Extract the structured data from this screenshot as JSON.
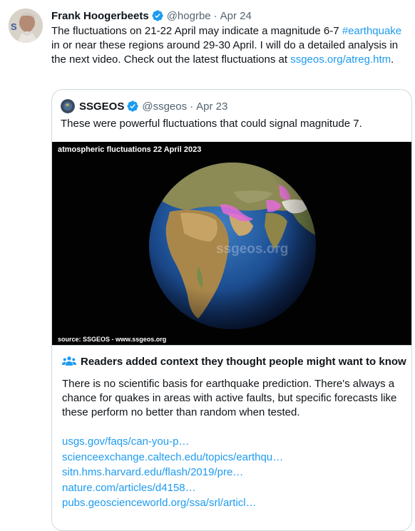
{
  "tweet": {
    "author_name": "Frank Hoogerbeets",
    "handle": "@hogrbe",
    "separator": "·",
    "date": "Apr 24",
    "text_part1": "The fluctuations on 21-22 April may indicate a magnitude 6-7 ",
    "hashtag": "#earthquake",
    "text_part2": " in or near these regions around 29-30 April. I will do a detailed analysis in the next video. Check out the latest fluctuations at ",
    "link": "ssgeos.org/atreg.htm",
    "text_end": "."
  },
  "quoted": {
    "author_name": "SSGEOS",
    "handle": "@ssgeos",
    "separator": "·",
    "date": "Apr 23",
    "text": "These were powerful fluctuations that could signal magnitude 7.",
    "media": {
      "title": "atmospheric fluctuations 22 April 2023",
      "watermark": "ssgeos.org",
      "source": "source: SSGEOS - www.ssgeos.org"
    }
  },
  "context": {
    "heading": "Readers added context they thought people might want to know",
    "body": "There is no scientific basis for earthquake prediction. There's always a chance for quakes in areas with active faults, but specific forecasts like these perform no better than random when tested.",
    "links": [
      "usgs.gov/faqs/can-you-p…",
      "scienceexchange.caltech.edu/topics/earthqu…",
      "sitn.hms.harvard.edu/flash/2019/pre…",
      "nature.com/articles/d4158…",
      "pubs.geoscienceworld.org/ssa/srl/articl…"
    ]
  },
  "colors": {
    "link": "#1d9bf0",
    "verified_badge": "#1d9bf0",
    "muted_text": "#536471",
    "border": "#cfd9de",
    "highlight_region": "#e36bd8"
  }
}
